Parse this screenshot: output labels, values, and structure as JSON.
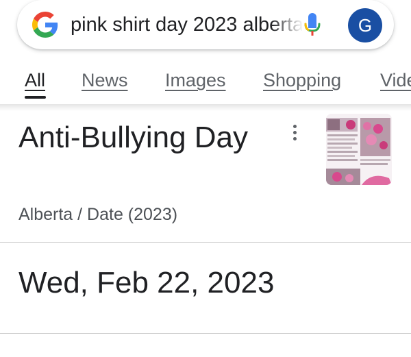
{
  "search": {
    "query": "pink shirt day 2023 alberta",
    "logo_icon": "google-g-icon",
    "mic_icon": "microphone-icon",
    "avatar_letter": "G",
    "avatar_color": "#1a4fa3"
  },
  "tabs": [
    {
      "label": "All",
      "active": true
    },
    {
      "label": "News",
      "active": false
    },
    {
      "label": "Images",
      "active": false
    },
    {
      "label": "Shopping",
      "active": false
    },
    {
      "label": "Videos",
      "active": false
    }
  ],
  "result": {
    "title": "Anti-Bullying Day",
    "subtitle": "Alberta / Date (2023)",
    "more_icon": "more-vert-icon",
    "answer": "Wed, Feb 22, 2023"
  }
}
